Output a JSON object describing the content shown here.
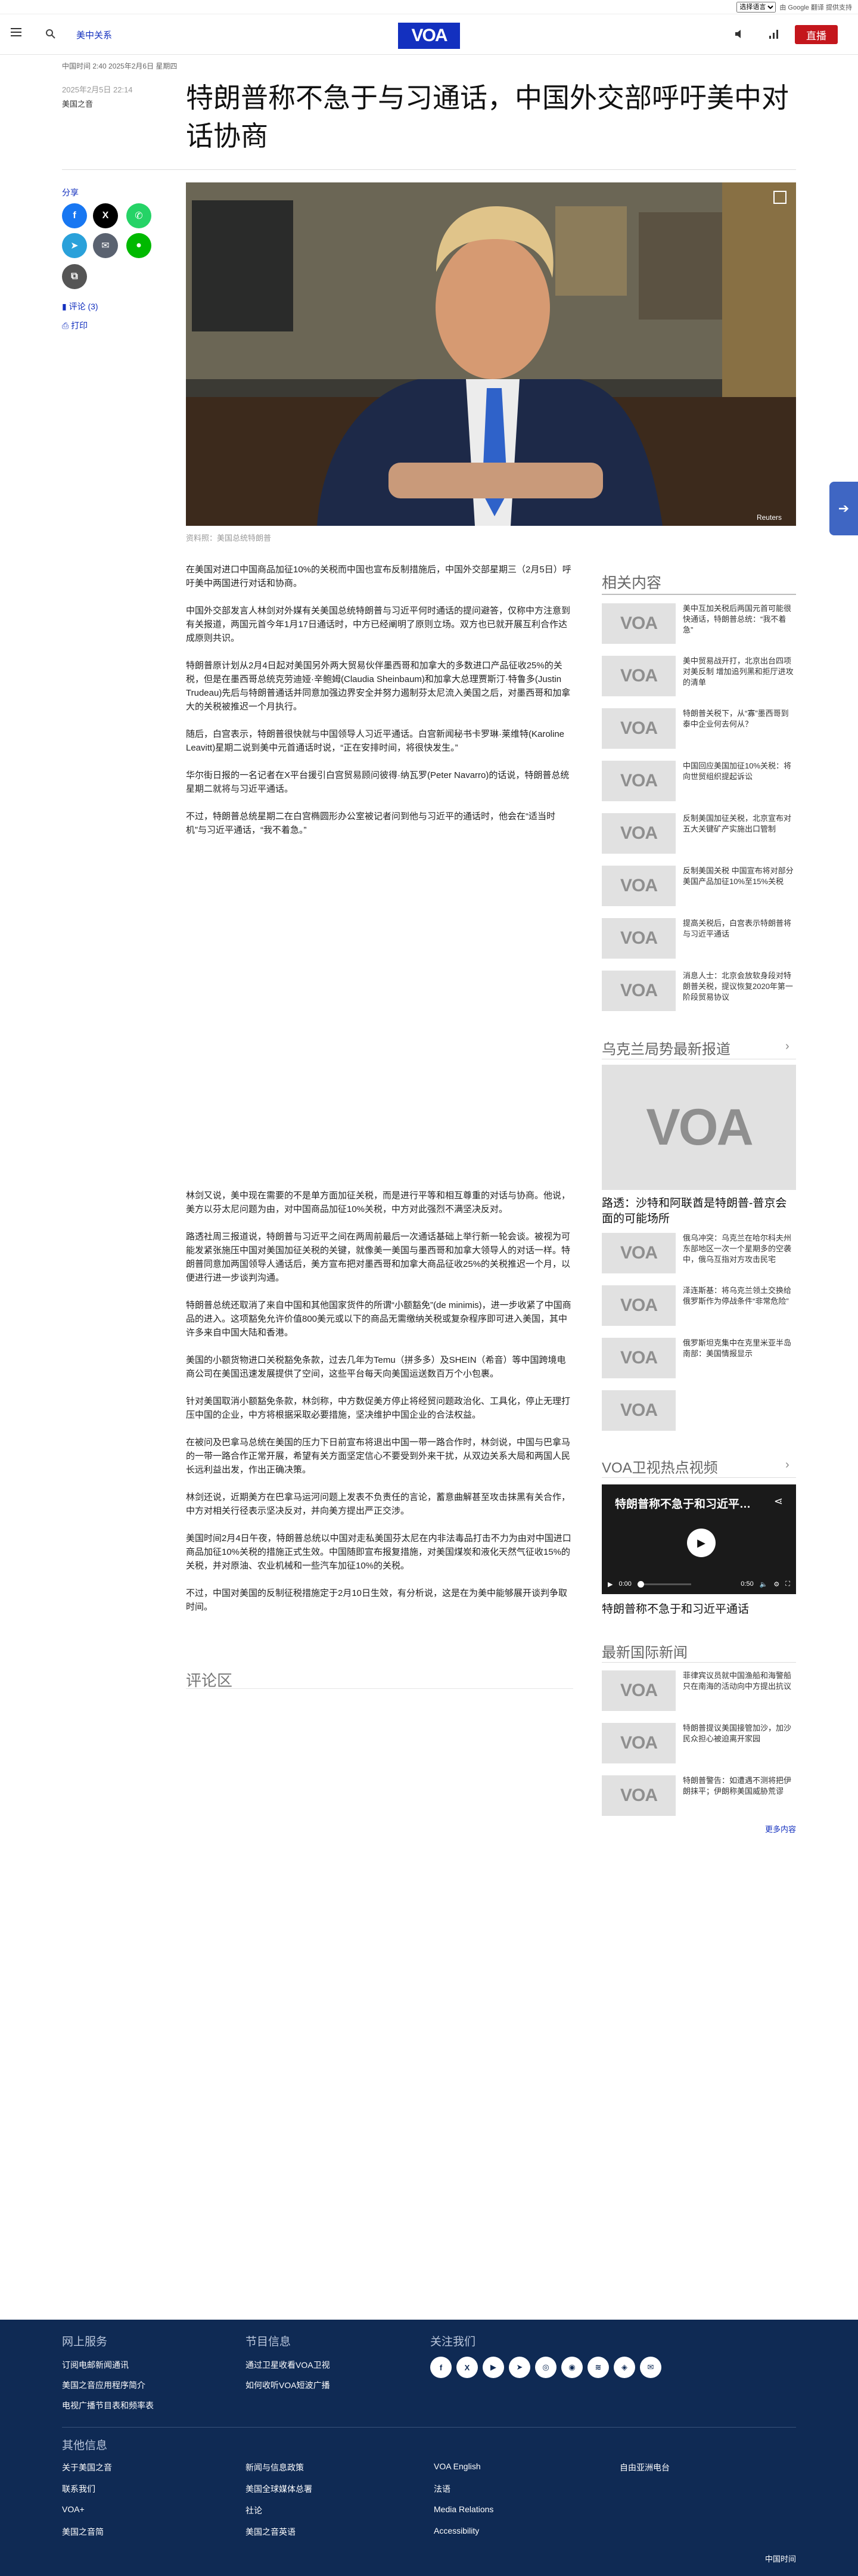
{
  "topbar": {
    "language_select": "选择语言",
    "google_text": "由 Google 翻译 提供支持"
  },
  "header": {
    "section": "美中关系",
    "logo": "VOA",
    "live": "直播"
  },
  "article": {
    "meta": "中国时间 2:40 2025年2月6日 星期四",
    "date": "2025年2月5日 22:14",
    "author": "美国之音",
    "title": "特朗普称不急于与习通话，中国外交部呼吁美中对话协商",
    "share": "分享",
    "comments_link": "评论 (3)",
    "print": "打印",
    "caption": "资料照：美国总统特朗普",
    "paragraphs_a": [
      "在美国对进口中国商品加征10%的关税而中国也宣布反制措施后，中国外交部星期三（2月5日）呼吁美中两国进行对话和协商。",
      "中国外交部发言人林剑对外媒有关美国总统特朗普与习近平何时通话的提问避答，仅称中方注意到有关报道，两国元首今年1月17日通话时，中方已经阐明了原则立场。双方也已就开展互利合作达成原则共识。",
      "特朗普原计划从2月4日起对美国另外两大贸易伙伴墨西哥和加拿大的多数进口产品征收25%的关税，但是在墨西哥总统克劳迪娅·辛鲍姆(Claudia Sheinbaum)和加拿大总理贾斯汀·特鲁多(Justin Trudeau)先后与特朗普通话并同意加强边界安全并努力遏制芬太尼流入美国之后，对墨西哥和加拿大的关税被推迟一个月执行。",
      "随后，白宫表示，特朗普很快就与中国领导人习近平通话。白宫新闻秘书卡罗琳·莱维特(Karoline Leavitt)星期二说到美中元首通话时说，“正在安排时间，将很快发生。”",
      "华尔街日报的一名记者在X平台援引白宫贸易顾问彼得·纳瓦罗(Peter Navarro)的话说，特朗普总统星期二就将与习近平通话。",
      "不过，特朗普总统星期二在白宫椭圆形办公室被记者问到他与习近平的通话时，他会在“适当时机”与习近平通话，“我不着急。”"
    ],
    "paragraphs_b": [
      "林剑又说，美中现在需要的不是单方面加征关税，而是进行平等和相互尊重的对话与协商。他说，美方以芬太尼问题为由，对中国商品加征10%关税，中方对此强烈不满坚决反对。",
      "路透社周三报道说，特朗普与习近平之间在两周前最后一次通话基础上举行新一轮会谈。被视为可能发紧张施压中国对美国加征关税的关键，就像美一美国与墨西哥和加拿大领导人的对话一样。特朗普同意加两国领导人通话后，美方宣布把对墨西哥和加拿大商品征收25%的关税推迟一个月，以便进行进一步谈判沟通。",
      "特朗普总统还取消了来自中国和其他国家货件的所谓“小额豁免”(de minimis)，进一步收紧了中国商品的进入。这项豁免允许价值800美元或以下的商品无需缴纳关税或复杂程序即可进入美国，其中许多来自中国大陆和香港。",
      "美国的小额货物进口关税豁免条款，过去几年为Temu（拼多多）及SHEIN（希音）等中国跨境电商公司在美国迅速发展提供了空间，这些平台每天向美国运送数百万个小包裹。",
      "针对美国取消小额豁免条款，林剑称，中方数促美方停止将经贸问题政治化、工具化，停止无理打压中国的企业，中方将根据采取必要措施，坚决维护中国企业的合法权益。",
      "在被问及巴拿马总统在美国的压力下日前宣布将退出中国一带一路合作时，林剑说，中国与巴拿马的一带一路合作正常开展，希望有关方面坚定信心不要受到外来干扰，从双边关系大局和两国人民长远利益出发，作出正确决策。",
      "林剑还说，近期美方在巴拿马运河问题上发表不负责任的言论，蓄意曲解甚至攻击抹黑有关合作，中方对相关行径表示坚决反对，并向美方提出严正交涉。",
      "美国时间2月4日午夜，特朗普总统以中国对走私美国芬太尼在内非法毒品打击不力为由对中国进口商品加征10%关税的措施正式生效。中国随即宣布报复措施，对美国煤炭和液化天然气征收15%的关税，并对原油、农业机械和一些汽车加征10%的关税。",
      "不过，中国对美国的反制征税措施定于2月10日生效，有分析说，这是在为美中能够展开谈判争取时间。"
    ],
    "comments_heading": "评论区"
  },
  "related": {
    "heading": "相关内容",
    "items": [
      "美中互加关税后两国元首可能很快通话，特朗普总统：“我不着急”",
      "美中贸易战开打，北京出台四项对美反制 增加追列黑和拒厅进攻的清单",
      "特朗普关税下，从“寡”墨西哥到泰中企业何去何从？",
      "中国回应美国加征10%关税：将向世贸组织提起诉讼",
      "反制美国加征关税，北京宣布对五大关键矿产实施出口管制",
      "反制美国关税 中国宣布将对部分美国产品加征10%至15%关税",
      "提高关税后，白宫表示特朗普将与习近平通话",
      "消息人士：北京会放软身段对特朗普关税，提议恢复2020年第一阶段贸易协议"
    ]
  },
  "ukraine": {
    "heading": "乌克兰局势最新报道",
    "feature_title": "路透：沙特和阿联酋是特朗普-普京会面的可能场所",
    "items": [
      "俄乌冲突：乌克兰在哈尔科夫州东部地区一次一个星期多的空袭中，俄乌互指对方攻击民宅",
      "泽连斯基：将乌克兰领土交换给俄罗斯作为停战条件“非常危险”",
      "俄罗斯坦克集中在克里米亚半岛南部：美国情报显示"
    ]
  },
  "video": {
    "heading": "VOA卫视热点视频",
    "title": "特朗普称不急于和习近平…",
    "time_current": "0:00",
    "time_total": "0:50",
    "caption": "特朗普称不急于和习近平通话"
  },
  "intl": {
    "heading": "最新国际新闻",
    "items": [
      "菲律宾议员就中国渔船和海警船只在南海的活动向中方提出抗议",
      "特朗普提议美国接管加沙，加沙民众担心被迫离开家园",
      "特朗普警告：如遭遇不测将把伊朗抹平；伊朗称美国威胁荒谬"
    ],
    "more": "更多内容"
  },
  "footer": {
    "col1_heading": "网上服务",
    "col1": [
      "订阅电邮新闻通讯",
      "美国之音应用程序简介",
      "电视广播节目表和频率表"
    ],
    "col2_heading": "节目信息",
    "col2": [
      "通过卫星收看VOA卫视",
      "如何收听VOA短波广播"
    ],
    "col3_heading": "关注我们",
    "other_heading": "其他信息",
    "links": [
      "关于美国之音",
      "新闻与信息政策",
      "VOA English",
      "自由亚洲电台",
      "联系我们",
      "美国全球媒体总署",
      "法语",
      "",
      "VOA+",
      "社论",
      "Media Relations",
      "",
      "美国之音简",
      "美国之音英语",
      "Accessibility",
      ""
    ],
    "bottom": "中国时间"
  }
}
